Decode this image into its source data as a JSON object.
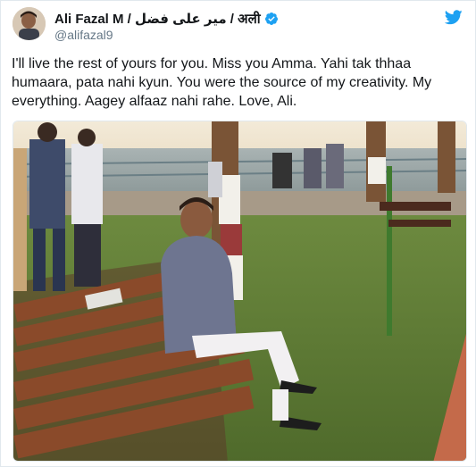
{
  "tweet": {
    "author_name": "Ali Fazal M / میر علی فضل / अली",
    "handle": "@alifazal9",
    "text": "I'll live the rest of yours for you. Miss you Amma. Yahi tak thhaa humaara, pata nahi kyun. You were the source of my creativity. My everything. Aagey alfaaz nahi rahe. Love, Ali.",
    "avatar_icon": "user-avatar",
    "verified_icon": "verified-badge-icon",
    "brand_icon": "twitter-bird-icon",
    "photo_icon": "photo-mother-on-bench-seaside"
  },
  "colors": {
    "brand_blue": "#1da1f2",
    "handle_grey": "#657786",
    "text_dark": "#14171a"
  }
}
